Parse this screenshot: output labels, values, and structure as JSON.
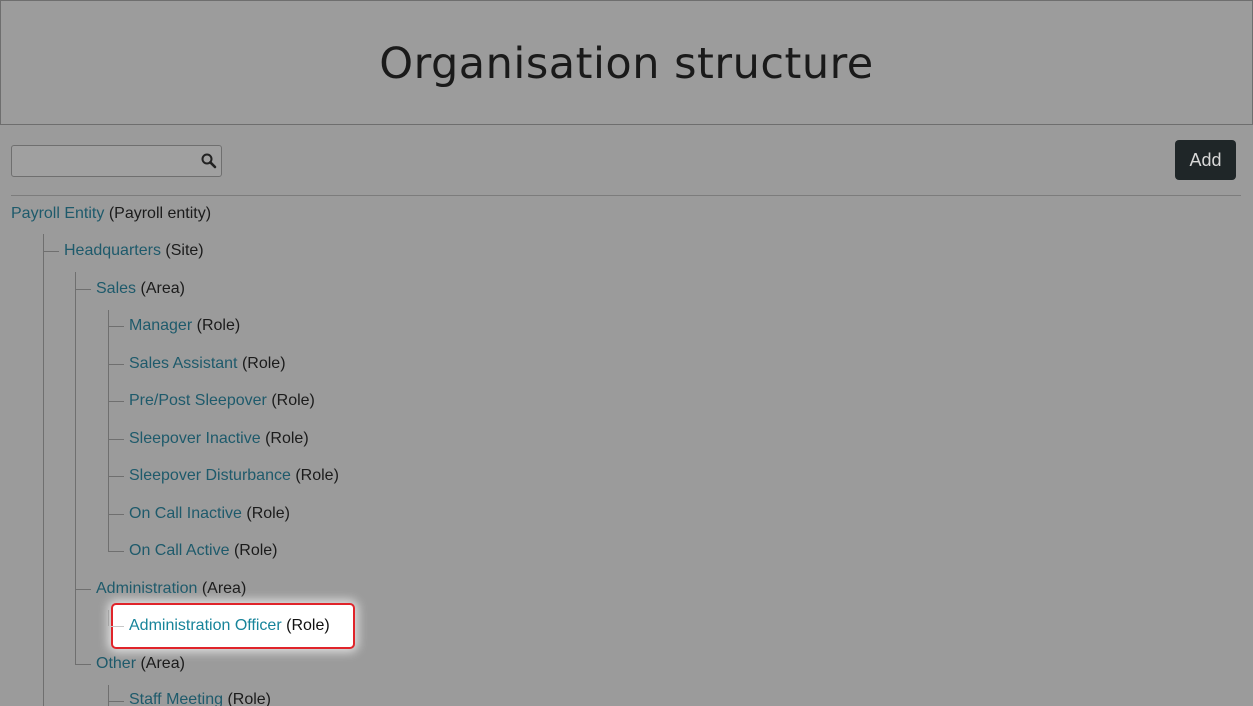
{
  "header": {
    "title": "Organisation structure"
  },
  "toolbar": {
    "search": {
      "value": "",
      "placeholder": ""
    },
    "add_label": "Add"
  },
  "tree": {
    "root": {
      "name": "Payroll Entity",
      "type": "(Payroll entity)"
    },
    "site": {
      "name": "Headquarters",
      "type": "(Site)"
    },
    "sales": {
      "name": "Sales",
      "type": "(Area)"
    },
    "sales_roles": [
      {
        "name": "Manager",
        "type": "(Role)"
      },
      {
        "name": "Sales Assistant",
        "type": "(Role)"
      },
      {
        "name": "Pre/Post Sleepover",
        "type": "(Role)"
      },
      {
        "name": "Sleepover Inactive",
        "type": "(Role)"
      },
      {
        "name": "Sleepover Disturbance",
        "type": "(Role)"
      },
      {
        "name": "On Call Inactive",
        "type": "(Role)"
      },
      {
        "name": "On Call Active",
        "type": "(Role)"
      }
    ],
    "administration": {
      "name": "Administration",
      "type": "(Area)"
    },
    "admin_roles": [
      {
        "name": "Administration Officer",
        "type": "(Role)"
      }
    ],
    "other": {
      "name": "Other",
      "type": "(Area)"
    },
    "other_roles": [
      {
        "name": "Staff Meeting",
        "type": "(Role)"
      }
    ]
  }
}
